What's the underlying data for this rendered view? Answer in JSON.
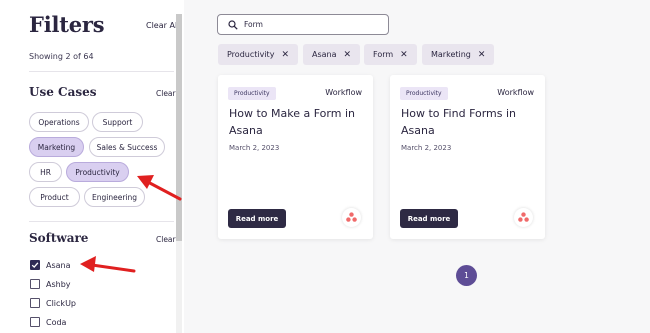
{
  "sidebar": {
    "title": "Filters",
    "clear_all": "Clear All",
    "showing": "Showing 2 of 64",
    "use_cases": {
      "title": "Use Cases",
      "clear": "Clear",
      "chips": [
        {
          "label": "Operations",
          "selected": false
        },
        {
          "label": "Support",
          "selected": false
        },
        {
          "label": "Marketing",
          "selected": true
        },
        {
          "label": "Sales & Success",
          "selected": false
        },
        {
          "label": "HR",
          "selected": false
        },
        {
          "label": "Productivity",
          "selected": true
        },
        {
          "label": "Product",
          "selected": false
        },
        {
          "label": "Engineering",
          "selected": false
        }
      ]
    },
    "software": {
      "title": "Software",
      "clear": "Clear",
      "options": [
        {
          "label": "Asana",
          "checked": true
        },
        {
          "label": "Ashby",
          "checked": false
        },
        {
          "label": "ClickUp",
          "checked": false
        },
        {
          "label": "Coda",
          "checked": false
        }
      ]
    }
  },
  "search": {
    "value": "Form",
    "icon": "search-icon"
  },
  "active_filters": [
    "Productivity",
    "Asana",
    "Form",
    "Marketing"
  ],
  "cards": [
    {
      "badge": "Productivity",
      "type": "Workflow",
      "title": "How to Make a Form in Asana",
      "date": "March 2, 2023",
      "button": "Read more"
    },
    {
      "badge": "Productivity",
      "type": "Workflow",
      "title": "How to Find Forms in Asana",
      "date": "March 2, 2023",
      "button": "Read more"
    }
  ],
  "pagination": {
    "current": "1"
  },
  "colors": {
    "accent": "#5e4d96",
    "chip_selected": "#d9cff0",
    "dark_button": "#2e2a44",
    "annotation_arrow": "#e02020"
  }
}
